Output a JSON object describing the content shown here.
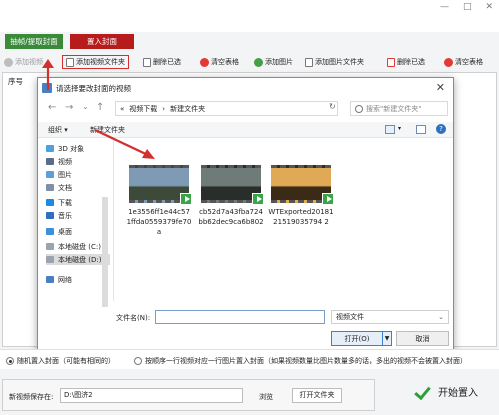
{
  "app": {
    "window_controls": [
      "—",
      "□",
      "✕"
    ],
    "mode_tabs": {
      "extract": "抽帧/提取封面",
      "insert": "置入封面"
    },
    "toolbar": {
      "add_video": "添加视频",
      "add_video_folder": "添加视频文件夹",
      "delete_selected": "删除已选",
      "clear_table": "清空表格",
      "add_image": "添加图片",
      "add_image_folder": "添加图片文件夹",
      "delete_selected_2": "删除已选",
      "clear_table_2": "清空表格"
    },
    "table": {
      "col_seq": "序号"
    }
  },
  "dialog": {
    "title": "请选择要改封面的视频",
    "close": "✕",
    "nav_back": "←",
    "nav_forward": "→",
    "nav_recent": "⌄",
    "nav_up": "↑",
    "breadcrumb": [
      "«",
      "视频下载",
      "›",
      "新建文件夹"
    ],
    "refresh": "↻",
    "search_placeholder": "搜索\"新建文件夹\"",
    "commands": {
      "organize": "组织 ▾",
      "new_folder": "新建文件夹"
    },
    "help": "?",
    "nav_items": [
      {
        "label": "3D 对象",
        "color": "#4aa3df"
      },
      {
        "label": "视频",
        "color": "#5b6b8a"
      },
      {
        "label": "图片",
        "color": "#5aa0d8"
      },
      {
        "label": "文档",
        "color": "#7f8fa6"
      },
      {
        "label": "下载",
        "color": "#1e88e5"
      },
      {
        "label": "音乐",
        "color": "#2f6fbf"
      },
      {
        "label": "桌面",
        "color": "#3c8fd8"
      },
      {
        "label": "本地磁盘 (C:)",
        "color": "#9aa4b0"
      },
      {
        "label": "本地磁盘 (D:)",
        "color": "#9aa4b0"
      },
      {
        "label": "网络",
        "color": "#4a7fc1"
      }
    ],
    "files": [
      {
        "name": "1e3556ff1e44c571ffda0559379fe70a",
        "sky": "#7f9ab5",
        "ground": "#3d4a3a"
      },
      {
        "name": "cb52d7a43fba724bb62dec9ca6b802",
        "sky": "#6f7b78",
        "ground": "#2a2e2a"
      },
      {
        "name": "WTExported2018121519035794 2",
        "sky": "#e0a955",
        "ground": "#3a2a16"
      }
    ],
    "filename_label": "文件名(N):",
    "filetype": "视频文件",
    "open": "打开(O)",
    "cancel": "取消"
  },
  "options": {
    "random": "随机置入封面（可能有相同的）",
    "sequential": "按顺序一行视频对应一行图片置入封面（如果视频数量比图片数量多的话，多出的视频不会被置入封面）"
  },
  "save": {
    "label": "新视频保存在:",
    "path": "D:\\图济2",
    "browse": "浏览",
    "open_folder": "打开文件夹",
    "start": "开始置入"
  },
  "colors": {
    "highlight": "#d32f2f",
    "green": "#3a8a3a",
    "red": "#b71c1c"
  }
}
